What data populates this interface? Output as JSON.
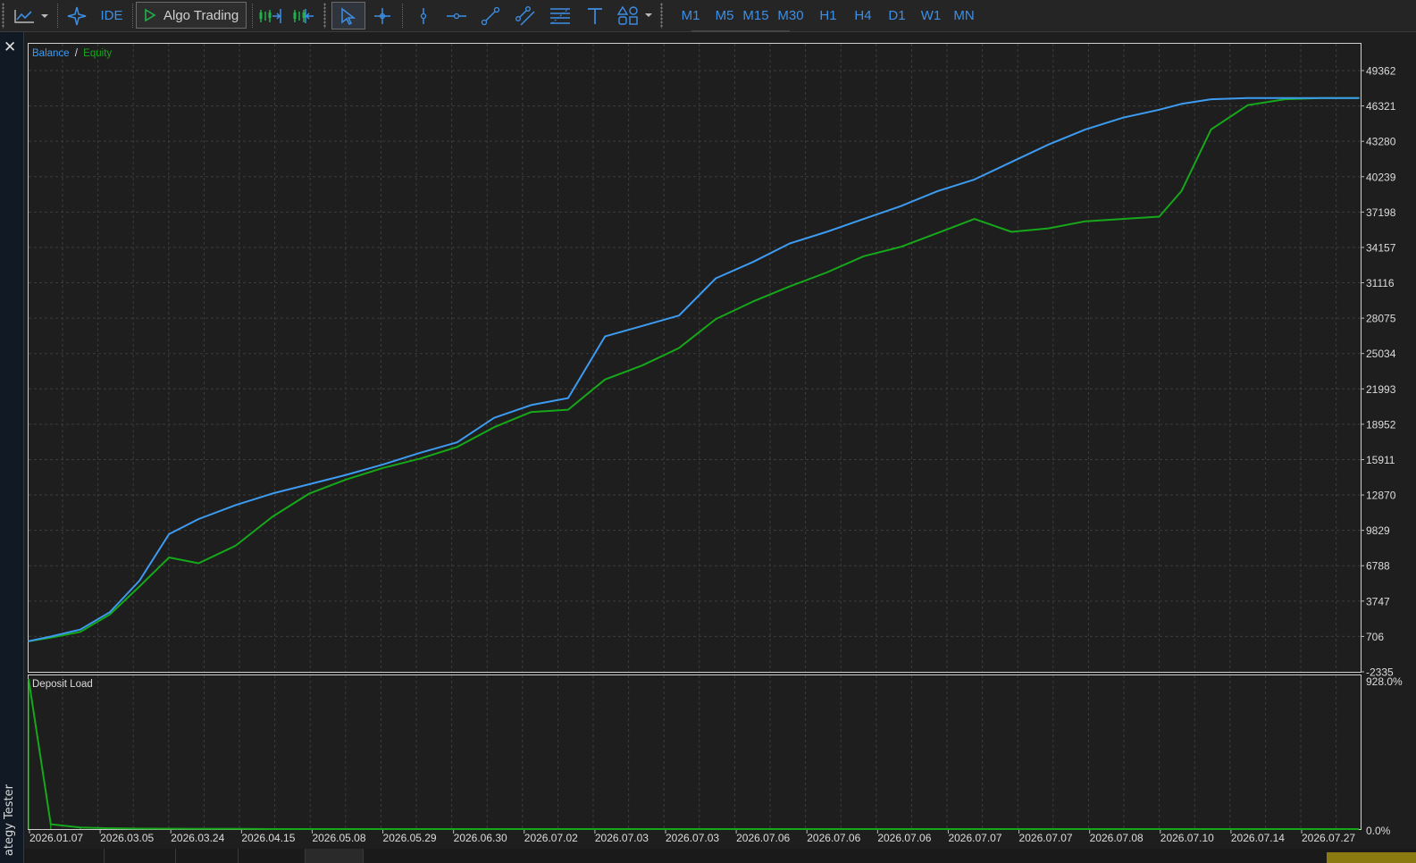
{
  "toolbar": {
    "ide_label": "IDE",
    "algo_trading_label": "Algo Trading",
    "timeframes": [
      "M1",
      "M5",
      "M15",
      "M30",
      "H1",
      "H4",
      "D1",
      "W1",
      "MN"
    ]
  },
  "side_panel": {
    "close_glyph": "✕",
    "label": "ategy Tester"
  },
  "main_chart": {
    "legend_balance": "Balance",
    "legend_separator": "/",
    "legend_equity": "Equity",
    "y_ticks": [
      "49362",
      "46321",
      "43280",
      "40239",
      "37198",
      "34157",
      "31116",
      "28075",
      "25034",
      "21993",
      "18952",
      "15911",
      "12870",
      "9829",
      "6788",
      "3747",
      "706",
      "-2335"
    ],
    "colors": {
      "balance": "#3d9bf0",
      "equity": "#16a81a",
      "background": "#1e1e1e",
      "grid": "#3c3c3c"
    }
  },
  "deposit_chart": {
    "label": "Deposit Load",
    "y_top": "928.0%",
    "y_bottom": "0.0%",
    "color": "#16a81a"
  },
  "x_axis": {
    "labels": [
      "2026.01.07",
      "2026.03.05",
      "2026.03.24",
      "2026.04.15",
      "2026.05.08",
      "2026.05.29",
      "2026.06.30",
      "2026.07.02",
      "2026.07.03",
      "2026.07.03",
      "2026.07.06",
      "2026.07.06",
      "2026.07.06",
      "2026.07.07",
      "2026.07.07",
      "2026.07.08",
      "2026.07.10",
      "2026.07.14",
      "2026.07.27"
    ]
  },
  "chart_data": {
    "type": "line",
    "title": "",
    "ylim": [
      -2335,
      49362
    ],
    "x_index": [
      0,
      3,
      7,
      11,
      15,
      19,
      23,
      28,
      33,
      38,
      43,
      48,
      53,
      58,
      63,
      68,
      73,
      78,
      83,
      88,
      93,
      98,
      103,
      108,
      113,
      118,
      123,
      128,
      133,
      138,
      143,
      148,
      153,
      156,
      160,
      165,
      170,
      175,
      180
    ],
    "series": [
      {
        "name": "Balance",
        "values": [
          300,
          700,
          1300,
          2800,
          5500,
          9500,
          10800,
          12000,
          13000,
          13800,
          14600,
          15500,
          16500,
          17400,
          19500,
          20600,
          21200,
          26500,
          27400,
          28300,
          31500,
          32900,
          34500,
          35500,
          36600,
          37700,
          39000,
          40000,
          41500,
          43000,
          44300,
          45300,
          46000,
          46500,
          46900,
          47000,
          47000,
          47000,
          47000
        ]
      },
      {
        "name": "Equity",
        "values": [
          300,
          600,
          1100,
          2600,
          5000,
          7500,
          7000,
          8500,
          11000,
          13000,
          14200,
          15200,
          16000,
          17000,
          18700,
          20000,
          20200,
          22800,
          24000,
          25500,
          28000,
          29500,
          30800,
          32000,
          33400,
          34200,
          35400,
          36600,
          35500,
          35800,
          36400,
          36600,
          36800,
          39000,
          44300,
          46400,
          46900,
          47000,
          47000
        ]
      }
    ],
    "deposit_load_percent": [
      928,
      30,
      10,
      5,
      3,
      2,
      1,
      1,
      0,
      0,
      0,
      0,
      0,
      0,
      0,
      0,
      0,
      0,
      0,
      0,
      0,
      0,
      0,
      0,
      0,
      0,
      0,
      0,
      0,
      0,
      0,
      0,
      0,
      0,
      0,
      0,
      0,
      0,
      0
    ],
    "deposit_ylim": [
      0,
      928
    ],
    "grid": true,
    "legend": "top-left"
  }
}
